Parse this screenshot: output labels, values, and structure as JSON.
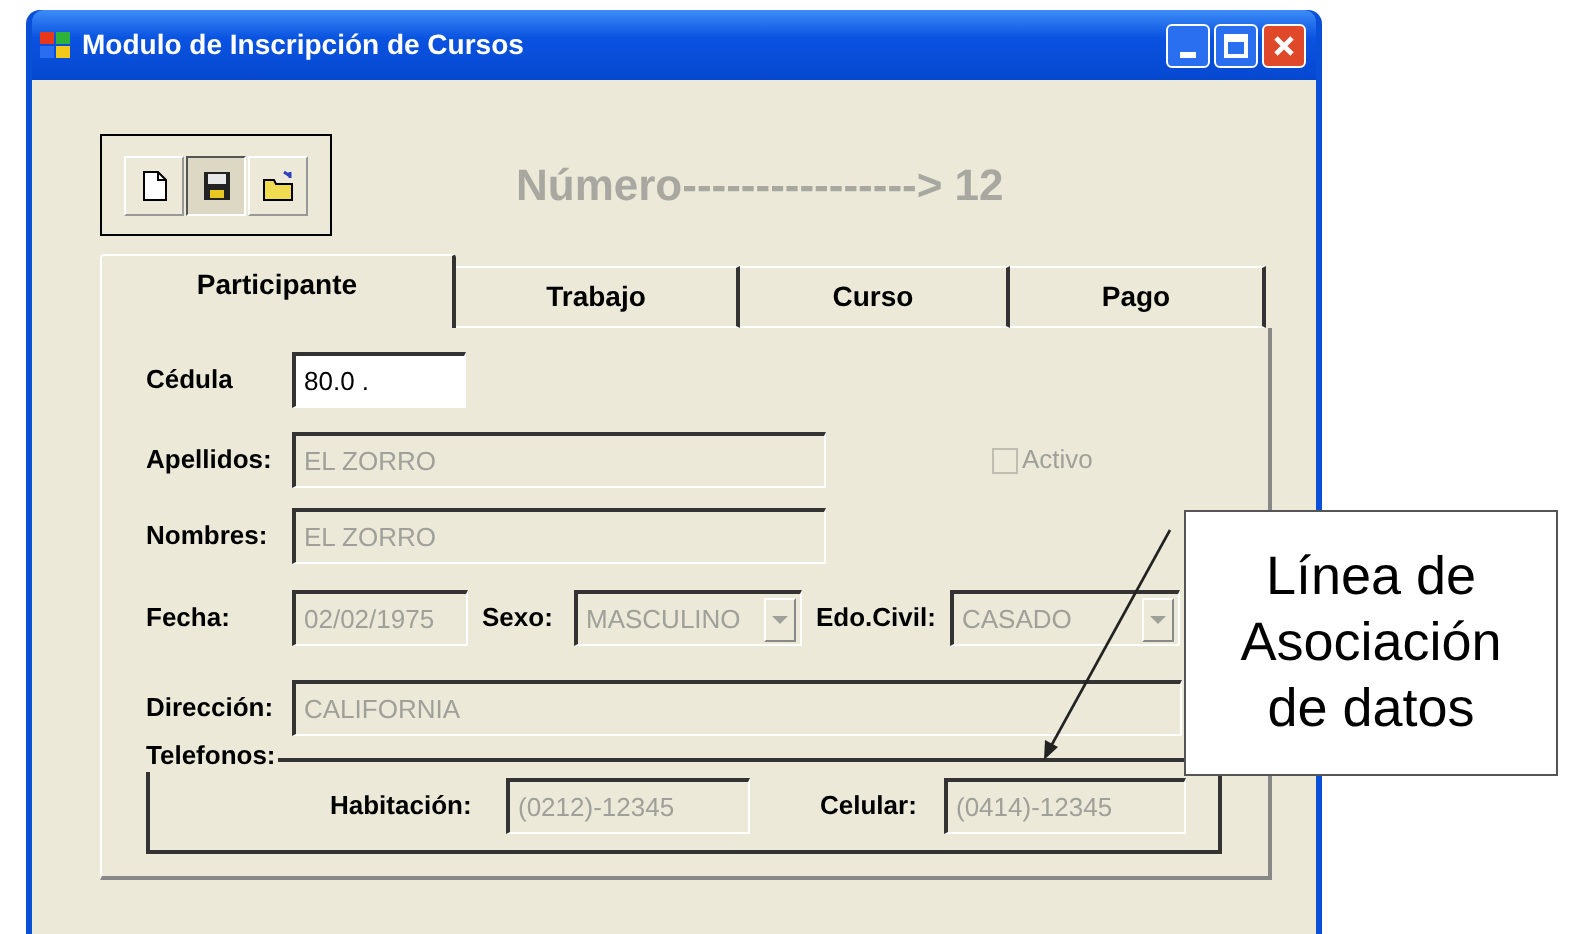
{
  "window": {
    "title": "Modulo de Inscripción de Cursos"
  },
  "toolbar": [
    {
      "kind": "new",
      "pressed": false
    },
    {
      "kind": "save",
      "pressed": true
    },
    {
      "kind": "open",
      "pressed": false
    }
  ],
  "record_number": "Número----------------> 12",
  "tabs": [
    {
      "label": "Participante",
      "selected": true
    },
    {
      "label": "Trabajo",
      "selected": false
    },
    {
      "label": "Curso",
      "selected": false
    },
    {
      "label": "Pago",
      "selected": false
    }
  ],
  "form_rows": [
    [
      {
        "kind": "text",
        "label": "Cédula",
        "value": "80.0  .",
        "disabled": false
      }
    ],
    [
      {
        "kind": "text",
        "label": "Apellidos:",
        "value": "EL ZORRO",
        "disabled": true
      },
      {
        "kind": "checkbox",
        "label": "Activo",
        "checked": false,
        "disabled": true
      }
    ],
    [
      {
        "kind": "text",
        "label": "Nombres:",
        "value": "EL ZORRO",
        "disabled": true
      }
    ],
    [
      {
        "kind": "text",
        "label": "Fecha:",
        "value": "02/02/1975",
        "disabled": true
      },
      {
        "kind": "combo",
        "label": "Sexo:",
        "value": "MASCULINO",
        "disabled": true
      },
      {
        "kind": "combo",
        "label": "Edo.Civil:",
        "value": "CASADO",
        "disabled": true
      }
    ],
    [
      {
        "kind": "text",
        "label": "Dirección:",
        "value": "CALIFORNIA",
        "disabled": true
      }
    ]
  ],
  "phones": {
    "title": "Telefonos:",
    "fields": [
      {
        "label": "Habitación:",
        "value": "(0212)-12345",
        "disabled": true
      },
      {
        "label": "Celular:",
        "value": "(0414)-12345",
        "disabled": true
      }
    ]
  },
  "callout": {
    "text": "Línea de Asociación de datos"
  }
}
